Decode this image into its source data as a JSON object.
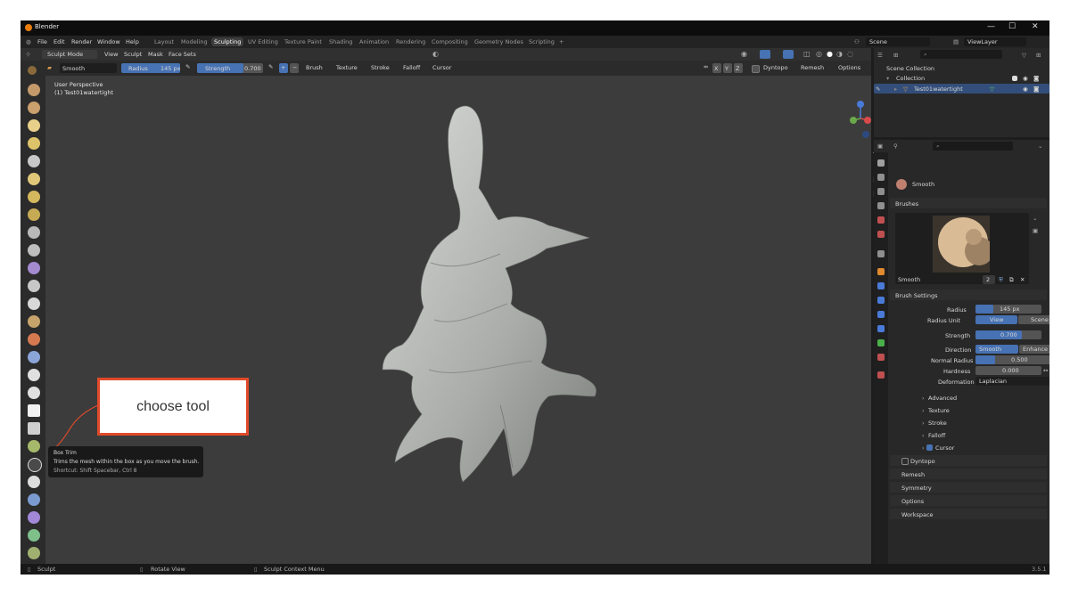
{
  "window": {
    "title": "Blender",
    "minimize": "—",
    "maximize": "☐",
    "close": "✕"
  },
  "menu": [
    "File",
    "Edit",
    "Render",
    "Window",
    "Help"
  ],
  "workspaces": [
    "Layout",
    "Modeling",
    "Sculpting",
    "UV Editing",
    "Texture Paint",
    "Shading",
    "Animation",
    "Rendering",
    "Compositing",
    "Geometry Nodes",
    "Scripting",
    "+"
  ],
  "scene": {
    "scene_name": "Scene",
    "view_layer": "ViewLayer"
  },
  "header": {
    "mode": "Sculpt Mode",
    "view": "View",
    "sculpt": "Sculpt",
    "mask": "Mask",
    "face_sets": "Face Sets",
    "brush_name": "Smooth",
    "radius_label": "Radius",
    "radius_value": "145 px",
    "strength_label": "Strength",
    "strength_value": "0.700",
    "brush": "Brush",
    "texture": "Texture",
    "stroke": "Stroke",
    "falloff": "Falloff",
    "cursor": "Cursor",
    "x": "X",
    "y": "Y",
    "z": "Z",
    "dyntopo": "Dyntopo",
    "remesh": "Remesh",
    "options": "Options"
  },
  "viewport": {
    "perspective": "User Perspective",
    "object": "(1) Test01watertight"
  },
  "outliner": {
    "root": "Scene Collection",
    "collection": "Collection",
    "object": "Test01watertight"
  },
  "properties": {
    "brush_header": "Smooth",
    "brushes": "Brushes",
    "brush_name": "Smooth",
    "user_count": "2",
    "brush_settings": "Brush Settings",
    "radius_label": "Radius",
    "radius_value": "145 px",
    "radius_unit_label": "Radius Unit",
    "unit_view": "View",
    "unit_scene": "Scene",
    "strength_label": "Strength",
    "strength_value": "0.700",
    "direction_label": "Direction",
    "dir_smooth": "Smooth",
    "dir_enhance": "Enhance ...",
    "normal_radius_label": "Normal Radius",
    "normal_radius_value": "0.500",
    "hardness_label": "Hardness",
    "hardness_value": "0.000",
    "deformation_label": "Deformation",
    "deformation_value": "Laplacian",
    "sub_sections": [
      "Advanced",
      "Texture",
      "Stroke",
      "Falloff",
      "Cursor"
    ],
    "panels": [
      "Dyntopo",
      "Remesh",
      "Symmetry",
      "Options",
      "Workspace"
    ]
  },
  "tooltip": {
    "title": "Box Trim",
    "desc": "Trims the mesh within the box as you move the brush.",
    "shortcut": "Shortcut: Shift Spacebar, Ctrl 8"
  },
  "callout": {
    "text": "choose tool"
  },
  "status": {
    "left": "Sculpt",
    "mid": "Rotate View",
    "right": "Sculpt Context Menu",
    "version": "3.5.1"
  },
  "colors": {
    "accent": "#4772b3",
    "callout_border": "#e04a2a",
    "logo": "#e87d0d"
  }
}
